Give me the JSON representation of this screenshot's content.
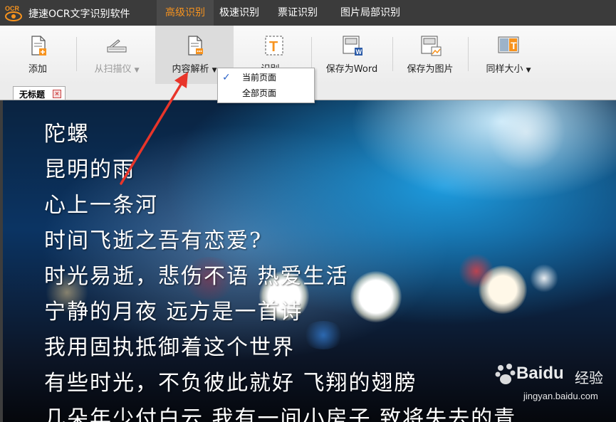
{
  "app": {
    "logo_text": "OCR",
    "title": "捷速OCR文字识别软件"
  },
  "menu": {
    "tabs": [
      {
        "label": "高级识别",
        "active": true
      },
      {
        "label": "极速识别",
        "active": false
      },
      {
        "label": "票证识别",
        "active": false
      },
      {
        "label": "图片局部识别",
        "active": false
      }
    ]
  },
  "toolbar": {
    "add": "添加",
    "scanner": "从扫描仪",
    "content_parse": "内容解析",
    "recognize": "识别",
    "save_word": "保存为Word",
    "save_image": "保存为图片",
    "same_size": "同样大小"
  },
  "dropdown": {
    "items": [
      {
        "label": "当前页面",
        "checked": true
      },
      {
        "label": "全部页面",
        "checked": false
      }
    ]
  },
  "document_tab": {
    "label": "无标题"
  },
  "image_text": {
    "lines": [
      "陀螺",
      "昆明的雨",
      "心上一条河",
      "时间飞逝之吾有恋爱?",
      "时光易逝，悲伤不语 热爱生活",
      "宁静的月夜 远方是一首诗",
      "我用固执抵御着这个世界",
      "有些时光，不负彼此就好 飞翔的翅膀",
      "几朵年少付白云 我有一间小房子 致将失去的青"
    ]
  },
  "watermark": {
    "brand": "Baidu",
    "brand_cn": "经验",
    "url": "jingyan.baidu.com"
  },
  "colors": {
    "menubar": "#3b3b3b",
    "active_tab_text": "#f7931e",
    "arrow": "#e8352a"
  }
}
